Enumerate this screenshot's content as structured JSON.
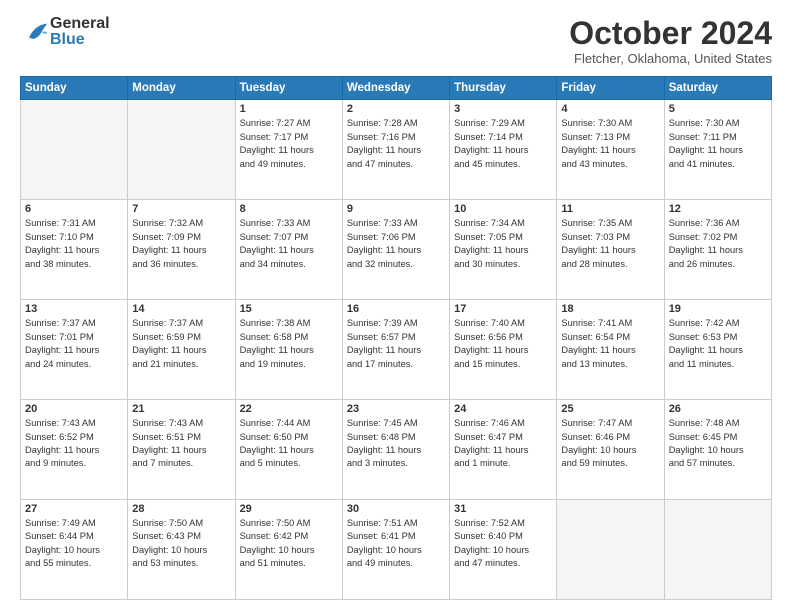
{
  "header": {
    "logo_general": "General",
    "logo_blue": "Blue",
    "month_title": "October 2024",
    "location": "Fletcher, Oklahoma, United States"
  },
  "days_of_week": [
    "Sunday",
    "Monday",
    "Tuesday",
    "Wednesday",
    "Thursday",
    "Friday",
    "Saturday"
  ],
  "weeks": [
    [
      {
        "day": "",
        "info": ""
      },
      {
        "day": "",
        "info": ""
      },
      {
        "day": "1",
        "info": "Sunrise: 7:27 AM\nSunset: 7:17 PM\nDaylight: 11 hours\nand 49 minutes."
      },
      {
        "day": "2",
        "info": "Sunrise: 7:28 AM\nSunset: 7:16 PM\nDaylight: 11 hours\nand 47 minutes."
      },
      {
        "day": "3",
        "info": "Sunrise: 7:29 AM\nSunset: 7:14 PM\nDaylight: 11 hours\nand 45 minutes."
      },
      {
        "day": "4",
        "info": "Sunrise: 7:30 AM\nSunset: 7:13 PM\nDaylight: 11 hours\nand 43 minutes."
      },
      {
        "day": "5",
        "info": "Sunrise: 7:30 AM\nSunset: 7:11 PM\nDaylight: 11 hours\nand 41 minutes."
      }
    ],
    [
      {
        "day": "6",
        "info": "Sunrise: 7:31 AM\nSunset: 7:10 PM\nDaylight: 11 hours\nand 38 minutes."
      },
      {
        "day": "7",
        "info": "Sunrise: 7:32 AM\nSunset: 7:09 PM\nDaylight: 11 hours\nand 36 minutes."
      },
      {
        "day": "8",
        "info": "Sunrise: 7:33 AM\nSunset: 7:07 PM\nDaylight: 11 hours\nand 34 minutes."
      },
      {
        "day": "9",
        "info": "Sunrise: 7:33 AM\nSunset: 7:06 PM\nDaylight: 11 hours\nand 32 minutes."
      },
      {
        "day": "10",
        "info": "Sunrise: 7:34 AM\nSunset: 7:05 PM\nDaylight: 11 hours\nand 30 minutes."
      },
      {
        "day": "11",
        "info": "Sunrise: 7:35 AM\nSunset: 7:03 PM\nDaylight: 11 hours\nand 28 minutes."
      },
      {
        "day": "12",
        "info": "Sunrise: 7:36 AM\nSunset: 7:02 PM\nDaylight: 11 hours\nand 26 minutes."
      }
    ],
    [
      {
        "day": "13",
        "info": "Sunrise: 7:37 AM\nSunset: 7:01 PM\nDaylight: 11 hours\nand 24 minutes."
      },
      {
        "day": "14",
        "info": "Sunrise: 7:37 AM\nSunset: 6:59 PM\nDaylight: 11 hours\nand 21 minutes."
      },
      {
        "day": "15",
        "info": "Sunrise: 7:38 AM\nSunset: 6:58 PM\nDaylight: 11 hours\nand 19 minutes."
      },
      {
        "day": "16",
        "info": "Sunrise: 7:39 AM\nSunset: 6:57 PM\nDaylight: 11 hours\nand 17 minutes."
      },
      {
        "day": "17",
        "info": "Sunrise: 7:40 AM\nSunset: 6:56 PM\nDaylight: 11 hours\nand 15 minutes."
      },
      {
        "day": "18",
        "info": "Sunrise: 7:41 AM\nSunset: 6:54 PM\nDaylight: 11 hours\nand 13 minutes."
      },
      {
        "day": "19",
        "info": "Sunrise: 7:42 AM\nSunset: 6:53 PM\nDaylight: 11 hours\nand 11 minutes."
      }
    ],
    [
      {
        "day": "20",
        "info": "Sunrise: 7:43 AM\nSunset: 6:52 PM\nDaylight: 11 hours\nand 9 minutes."
      },
      {
        "day": "21",
        "info": "Sunrise: 7:43 AM\nSunset: 6:51 PM\nDaylight: 11 hours\nand 7 minutes."
      },
      {
        "day": "22",
        "info": "Sunrise: 7:44 AM\nSunset: 6:50 PM\nDaylight: 11 hours\nand 5 minutes."
      },
      {
        "day": "23",
        "info": "Sunrise: 7:45 AM\nSunset: 6:48 PM\nDaylight: 11 hours\nand 3 minutes."
      },
      {
        "day": "24",
        "info": "Sunrise: 7:46 AM\nSunset: 6:47 PM\nDaylight: 11 hours\nand 1 minute."
      },
      {
        "day": "25",
        "info": "Sunrise: 7:47 AM\nSunset: 6:46 PM\nDaylight: 10 hours\nand 59 minutes."
      },
      {
        "day": "26",
        "info": "Sunrise: 7:48 AM\nSunset: 6:45 PM\nDaylight: 10 hours\nand 57 minutes."
      }
    ],
    [
      {
        "day": "27",
        "info": "Sunrise: 7:49 AM\nSunset: 6:44 PM\nDaylight: 10 hours\nand 55 minutes."
      },
      {
        "day": "28",
        "info": "Sunrise: 7:50 AM\nSunset: 6:43 PM\nDaylight: 10 hours\nand 53 minutes."
      },
      {
        "day": "29",
        "info": "Sunrise: 7:50 AM\nSunset: 6:42 PM\nDaylight: 10 hours\nand 51 minutes."
      },
      {
        "day": "30",
        "info": "Sunrise: 7:51 AM\nSunset: 6:41 PM\nDaylight: 10 hours\nand 49 minutes."
      },
      {
        "day": "31",
        "info": "Sunrise: 7:52 AM\nSunset: 6:40 PM\nDaylight: 10 hours\nand 47 minutes."
      },
      {
        "day": "",
        "info": ""
      },
      {
        "day": "",
        "info": ""
      }
    ]
  ]
}
